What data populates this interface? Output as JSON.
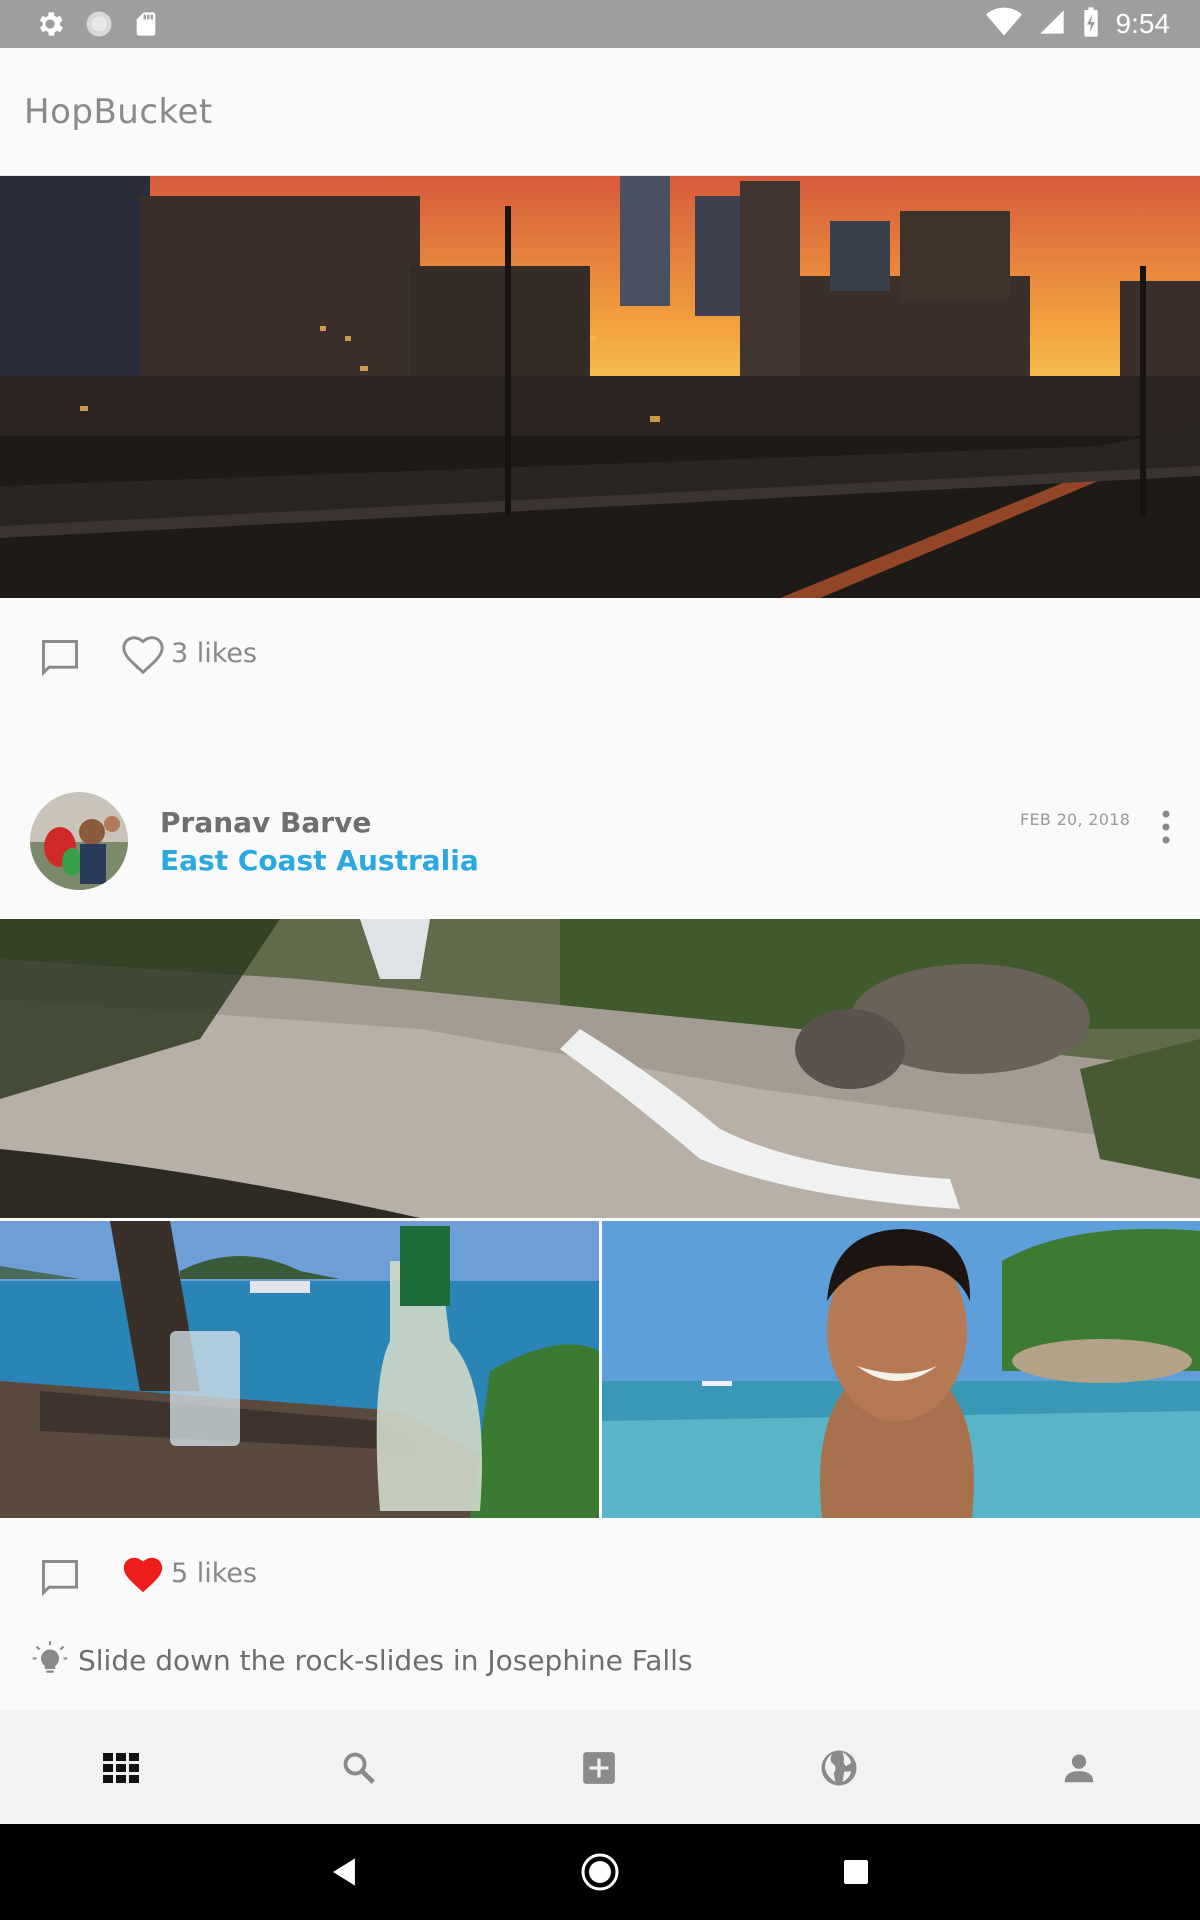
{
  "status_bar": {
    "time": "9:54",
    "left_icons": [
      "gear-icon",
      "circle-icon",
      "sd-card-icon"
    ],
    "right_icons": [
      "wifi-icon",
      "signal-icon",
      "battery-charging-icon"
    ]
  },
  "app": {
    "title": "HopBucket"
  },
  "feed": {
    "posts": [
      {
        "image": "city-skyline-sunset",
        "likes_text": "3 likes",
        "liked": false
      },
      {
        "author": "Pranav Barve",
        "location": "East Coast Australia",
        "date": "FEB 20, 2018",
        "images": [
          "waterfall-rock-slides",
          "beach-table-drink",
          "beach-selfie"
        ],
        "likes_text": "5 likes",
        "liked": true,
        "caption": "Slide down the rock-slides in Josephine Falls"
      }
    ]
  },
  "bottom_nav": {
    "items": [
      "grid-icon",
      "search-icon",
      "add-box-icon",
      "globe-icon",
      "person-icon"
    ],
    "active": "grid-icon"
  },
  "system_nav": {
    "items": [
      "back-icon",
      "home-icon",
      "recents-icon"
    ]
  },
  "colors": {
    "accent": "#29a9e0",
    "like_active": "#ee1c1c",
    "status_bar": "#9e9e9e"
  }
}
